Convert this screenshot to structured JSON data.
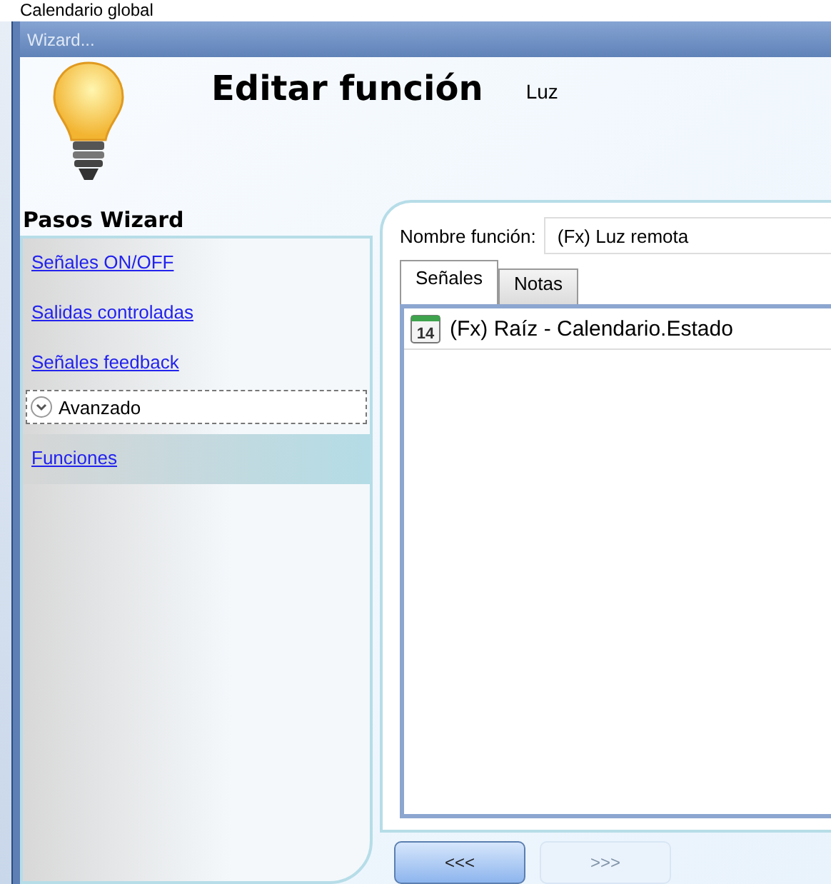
{
  "caption": "Calendario global",
  "window": {
    "title": "Wizard..."
  },
  "header": {
    "title": "Editar función",
    "subtitle": "Luz"
  },
  "sidebar": {
    "title": "Pasos Wizard",
    "items": [
      {
        "kind": "link",
        "label": "Señales ON/OFF",
        "selected": false
      },
      {
        "kind": "link",
        "label": "Salidas controladas",
        "selected": false
      },
      {
        "kind": "link",
        "label": "Señales feedback",
        "selected": false
      },
      {
        "kind": "group",
        "label": "Avanzado",
        "expanded": false
      },
      {
        "kind": "link",
        "label": "Funciones",
        "selected": true
      }
    ]
  },
  "form": {
    "name_label": "Nombre función:",
    "name_value": "(Fx) Luz remota",
    "tabs": [
      {
        "label": "Señales",
        "selected": true
      },
      {
        "label": "Notas",
        "selected": false
      }
    ],
    "signals": [
      {
        "icon_text": "14",
        "label": "(Fx) Raíz - Calendario.Estado"
      }
    ]
  },
  "buttons": [
    {
      "label": "<<<",
      "disabled": false
    },
    {
      "label": ">>>",
      "disabled": true
    }
  ]
}
